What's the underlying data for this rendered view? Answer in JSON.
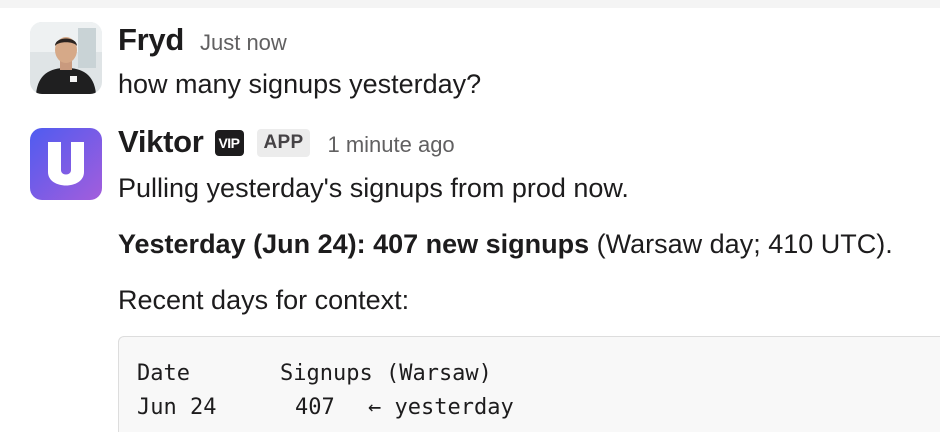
{
  "messages": [
    {
      "author": "Fryd",
      "timestamp": "Just now",
      "text": "how many signups yesterday?"
    },
    {
      "author": "Viktor",
      "vip_badge": "VIP",
      "app_badge": "APP",
      "timestamp": "1 minute ago",
      "line1": "Pulling yesterday's signups from prod now.",
      "line2_bold": "Yesterday (Jun 24): 407 new signups",
      "line2_rest": " (Warsaw day; 410 UTC).",
      "line3": "Recent days for context:",
      "code": {
        "header": [
          "Date",
          "Signups (Warsaw)"
        ],
        "rows": [
          {
            "date": "Jun 24",
            "signups": "407",
            "note": "← yesterday"
          }
        ]
      }
    }
  ],
  "colors": {
    "viktor_avatar_gradient": [
      "#4f5cf0",
      "#a35ddc"
    ],
    "text": "#1d1c1d",
    "muted": "#616061"
  }
}
